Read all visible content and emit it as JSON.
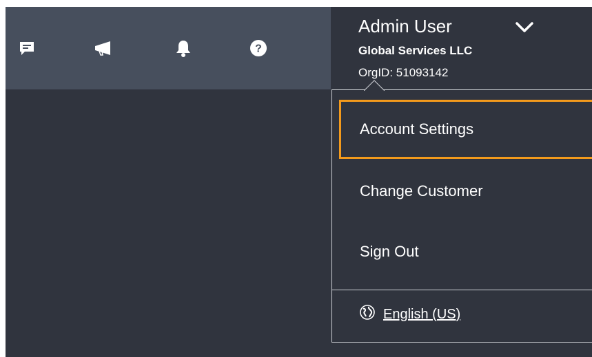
{
  "toolbar": {
    "icons": [
      "feedback-icon",
      "megaphone-icon",
      "bell-icon",
      "help-icon"
    ]
  },
  "user": {
    "name": "Admin User",
    "organization": "Global Services LLC",
    "org_id": "OrgID: 51093142"
  },
  "menu": {
    "items": [
      {
        "label": "Account Settings",
        "focused": true
      },
      {
        "label": "Change Customer",
        "focused": false
      },
      {
        "label": "Sign Out",
        "focused": false
      }
    ],
    "language": {
      "label": "English (US)",
      "icon": "globe-icon"
    }
  },
  "colors": {
    "toolbar_bg": "#474f5d",
    "page_bg": "#30343e",
    "focus_border": "#f39a1c",
    "divider": "#d0d3d8"
  }
}
